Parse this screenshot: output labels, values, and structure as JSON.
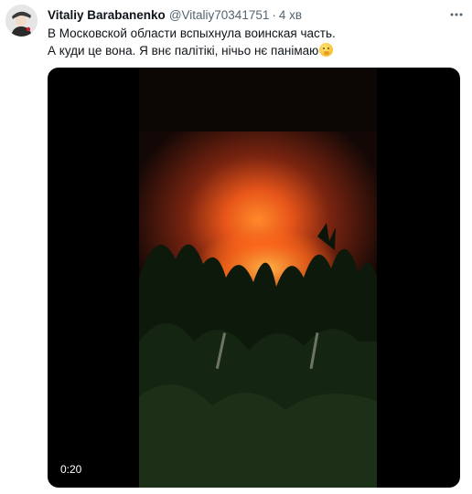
{
  "tweet": {
    "author": {
      "display_name": "Vitaliy Barabanenko",
      "handle": "@Vitaliy70341751",
      "avatar": "avatar"
    },
    "separator": "·",
    "time": "4 хв",
    "more_icon": "more-horizontal-icon",
    "text_lines": [
      "В Московской области вспыхнула воинская часть.",
      "А куди це вона. Я внє палітікі, нічьо нє панімаю"
    ],
    "emoji": "face-with-hand-over-mouth",
    "media": {
      "kind": "video",
      "duration": "0:20"
    }
  },
  "colors": {
    "text_primary": "#0f1419",
    "text_secondary": "#536471",
    "media_background": "#000000",
    "fire_glow": "#ff5a10"
  }
}
